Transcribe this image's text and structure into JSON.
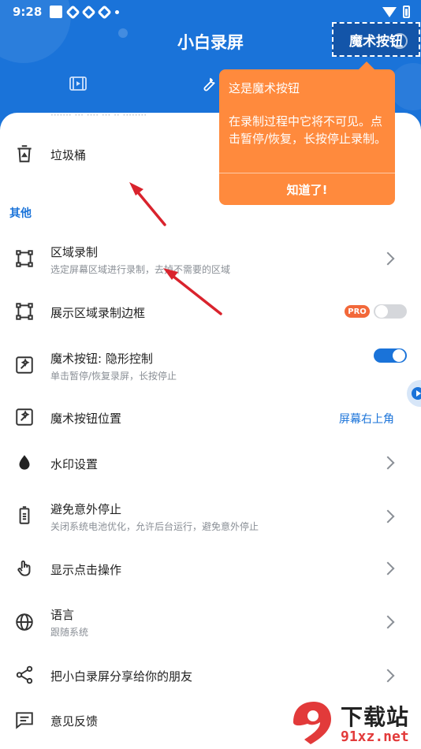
{
  "status_bar": {
    "time": "9:28"
  },
  "header": {
    "title": "小白录屏",
    "magic_button_label": "魔术按钮"
  },
  "tooltip": {
    "title": "这是魔术按钮",
    "body": "在录制过程中它将不可见。点击暂停/恢复，长按停止录制。",
    "action": "知道了!"
  },
  "list": {
    "trash": {
      "label": "垃圾桶",
      "icon": "trash-icon"
    },
    "section_other": "其他",
    "region_record": {
      "label": "区域录制",
      "sub": "选定屏幕区域进行录制，去掉不需要的区域",
      "icon": "crop-frame-icon"
    },
    "show_region_border": {
      "label": "展示区域录制边框",
      "badge": "PRO",
      "toggle": false,
      "icon": "frame-icon"
    },
    "magic_invisible": {
      "label": "魔术按钮: 隐形控制",
      "sub": "单击暂停/恢复录屏，长按停止",
      "toggle": true,
      "icon": "magic-wand-icon"
    },
    "magic_position": {
      "label": "魔术按钮位置",
      "value": "屏幕右上角",
      "icon": "magic-wand-icon"
    },
    "watermark": {
      "label": "水印设置",
      "icon": "drop-icon"
    },
    "avoid_stop": {
      "label": "避免意外停止",
      "sub": "关闭系统电池优化，允许后台运行，避免意外停止",
      "icon": "battery-icon"
    },
    "show_touch": {
      "label": "显示点击操作",
      "icon": "touch-icon"
    },
    "language": {
      "label": "语言",
      "sub": "跟随系统",
      "icon": "globe-icon"
    },
    "share": {
      "label": "把小白录屏分享给你的朋友",
      "icon": "share-icon"
    },
    "feedback": {
      "label": "意见反馈",
      "icon": "feedback-icon"
    }
  },
  "watermark_logo": {
    "title": "下载站",
    "url": "91xz.net"
  },
  "colors": {
    "primary": "#1a73d9",
    "tooltip": "#ff8a3d",
    "pro": "#f2683a",
    "arrow": "#d9232d"
  }
}
